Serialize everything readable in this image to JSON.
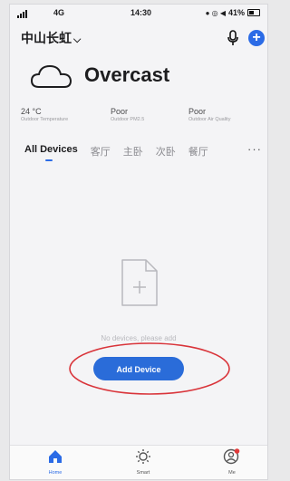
{
  "status_bar": {
    "network": "4G",
    "time": "14:30",
    "battery": "41%"
  },
  "header": {
    "home_name": "中山长虹",
    "dropdown_icon": "chevron-down-icon",
    "voice_icon": "microphone-icon",
    "add_icon": "plus-icon"
  },
  "weather": {
    "condition": "Overcast",
    "stats": [
      {
        "value": "24 °C",
        "label": "Outdoor Temperature"
      },
      {
        "value": "Poor",
        "label": "Outdoor PM2.5"
      },
      {
        "value": "Poor",
        "label": "Outdoor Air Quality"
      }
    ]
  },
  "tabs": [
    {
      "label": "All Devices",
      "active": true
    },
    {
      "label": "客厅"
    },
    {
      "label": "主卧"
    },
    {
      "label": "次卧"
    },
    {
      "label": "餐厅"
    }
  ],
  "more_label": "···",
  "empty_state": {
    "message": "No devices, please add",
    "button_label": "Add Device"
  },
  "bottom_nav": [
    {
      "label": "Home",
      "icon": "home-icon",
      "active": true
    },
    {
      "label": "Smart",
      "icon": "smart-icon"
    },
    {
      "label": "Me",
      "icon": "profile-icon"
    }
  ],
  "colors": {
    "accent": "#2b6be6",
    "annotation": "#d9343a"
  }
}
